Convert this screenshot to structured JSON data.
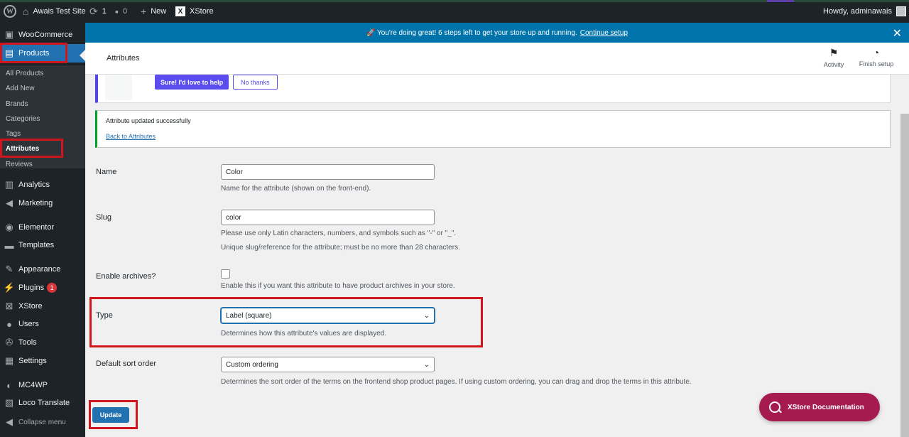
{
  "admin_bar": {
    "site_name": "Awais Test Site",
    "updates_count": "1",
    "comments_count": "0",
    "new_label": "New",
    "xstore_label": "XStore",
    "howdy": "Howdy, adminawais"
  },
  "sidebar": {
    "woocommerce": "WooCommerce",
    "products": "Products",
    "sub": [
      "All Products",
      "Add New",
      "Brands",
      "Categories",
      "Tags",
      "Attributes",
      "Reviews"
    ],
    "analytics": "Analytics",
    "marketing": "Marketing",
    "elementor": "Elementor",
    "templates": "Templates",
    "appearance": "Appearance",
    "plugins": "Plugins",
    "plugins_badge": "1",
    "xstore": "XStore",
    "users": "Users",
    "tools": "Tools",
    "settings": "Settings",
    "mc4wp": "MC4WP",
    "loco": "Loco Translate",
    "collapse": "Collapse menu"
  },
  "notice": {
    "text": "🚀 You're doing great! 6 steps left to get your store up and running.",
    "link": "Continue setup"
  },
  "header": {
    "title": "Attributes",
    "activity": "Activity",
    "finish_setup": "Finish setup"
  },
  "promo": {
    "yes_button": "Sure! I'd love to help",
    "no_button": "No thanks"
  },
  "updated_notice": {
    "message": "Attribute updated successfully",
    "back_link": "Back to Attributes"
  },
  "form": {
    "name_label": "Name",
    "name_value": "Color",
    "name_desc": "Name for the attribute (shown on the front-end).",
    "slug_label": "Slug",
    "slug_value": "color",
    "slug_desc1": "Please use only Latin characters, numbers, and symbols such as \"-\" or \"_\".",
    "slug_desc2": "Unique slug/reference for the attribute; must be no more than 28 characters.",
    "archives_label": "Enable archives?",
    "archives_desc": "Enable this if you want this attribute to have product archives in your store.",
    "type_label": "Type",
    "type_value": "Label (square)",
    "type_desc": "Determines how this attribute's values are displayed.",
    "sort_label": "Default sort order",
    "sort_value": "Custom ordering",
    "sort_desc": "Determines the sort order of the terms on the frontend shop product pages. If using custom ordering, you can drag and drop the terms in this attribute.",
    "update_button": "Update"
  },
  "xstore_doc": "XStore Documentation",
  "colors": {
    "accent_blue": "#2271b1",
    "admin_dark": "#1d2327",
    "highlight_red": "#d0151d",
    "xstore_doc_bg": "#a51a4f"
  }
}
